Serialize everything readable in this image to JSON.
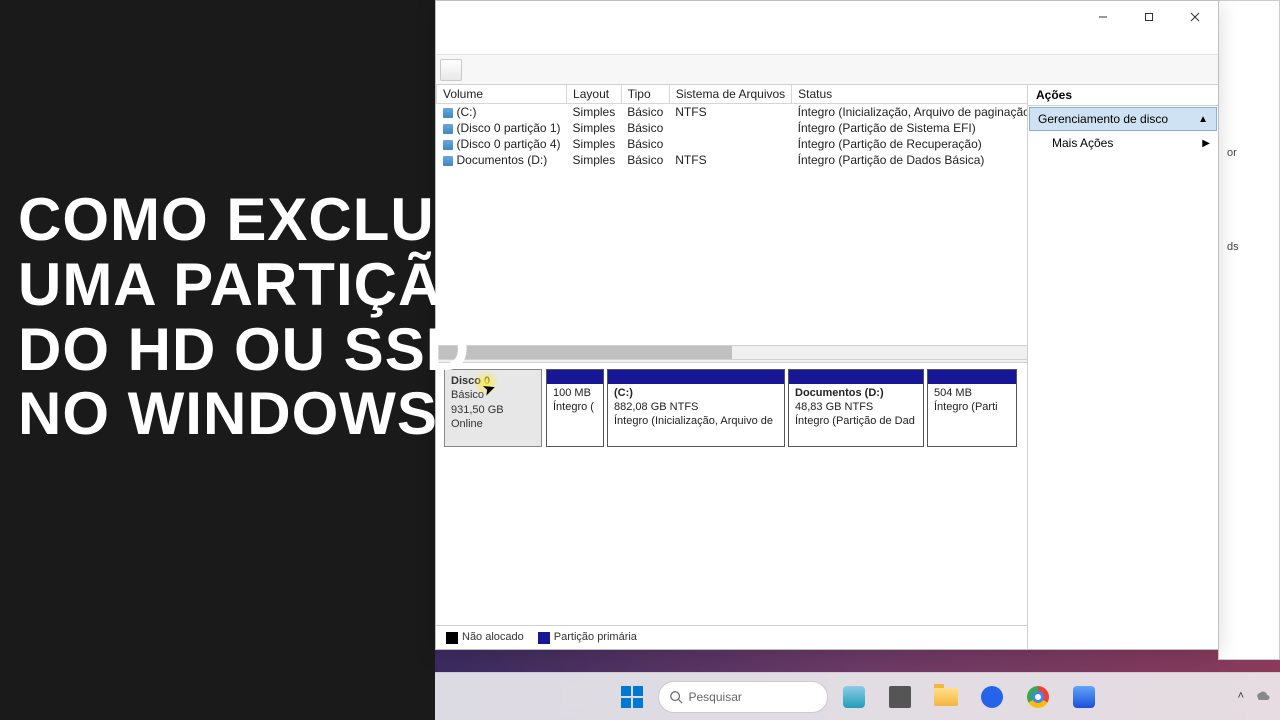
{
  "overlay": {
    "line1": "COMO EXCLUIR",
    "line2": "UMA PARTIÇÃO",
    "line3": "DO HD OU SSD",
    "line4": "NO WINDOWS"
  },
  "bg_window": {
    "row1": "or",
    "row2": "ds"
  },
  "table": {
    "headers": {
      "volume": "Volume",
      "layout": "Layout",
      "tipo": "Tipo",
      "fs": "Sistema de Arquivos",
      "status": "Status"
    },
    "rows": [
      {
        "vol": "(C:)",
        "layout": "Simples",
        "tipo": "Básico",
        "fs": "NTFS",
        "status": "Íntegro (Inicialização, Arquivo de paginação, D"
      },
      {
        "vol": "(Disco 0 partição 1)",
        "layout": "Simples",
        "tipo": "Básico",
        "fs": "",
        "status": "Íntegro (Partição de Sistema EFI)"
      },
      {
        "vol": "(Disco 0 partição 4)",
        "layout": "Simples",
        "tipo": "Básico",
        "fs": "",
        "status": "Íntegro (Partição de Recuperação)"
      },
      {
        "vol": "Documentos (D:)",
        "layout": "Simples",
        "tipo": "Básico",
        "fs": "NTFS",
        "status": "Íntegro (Partição de Dados Básica)"
      }
    ]
  },
  "disk": {
    "name": "Disco 0",
    "type": "Básico",
    "size": "931,50 GB",
    "state": "Online",
    "partitions": [
      {
        "title": "",
        "sub": "100 MB",
        "status": "Íntegro (",
        "width": 58
      },
      {
        "title": "(C:)",
        "sub": "882,08 GB NTFS",
        "status": "Íntegro (Inicialização, Arquivo de",
        "width": 178
      },
      {
        "title": "Documentos  (D:)",
        "sub": "48,83 GB NTFS",
        "status": "Íntegro (Partição de Dad",
        "width": 136
      },
      {
        "title": "",
        "sub": "504 MB",
        "status": "Íntegro (Parti",
        "width": 90
      }
    ]
  },
  "legend": {
    "unalloc": "Não alocado",
    "primary": "Partição primária"
  },
  "actions": {
    "header": "Ações",
    "group": "Gerenciamento de disco",
    "more": "Mais Ações"
  },
  "taskbar": {
    "search": "Pesquisar"
  }
}
